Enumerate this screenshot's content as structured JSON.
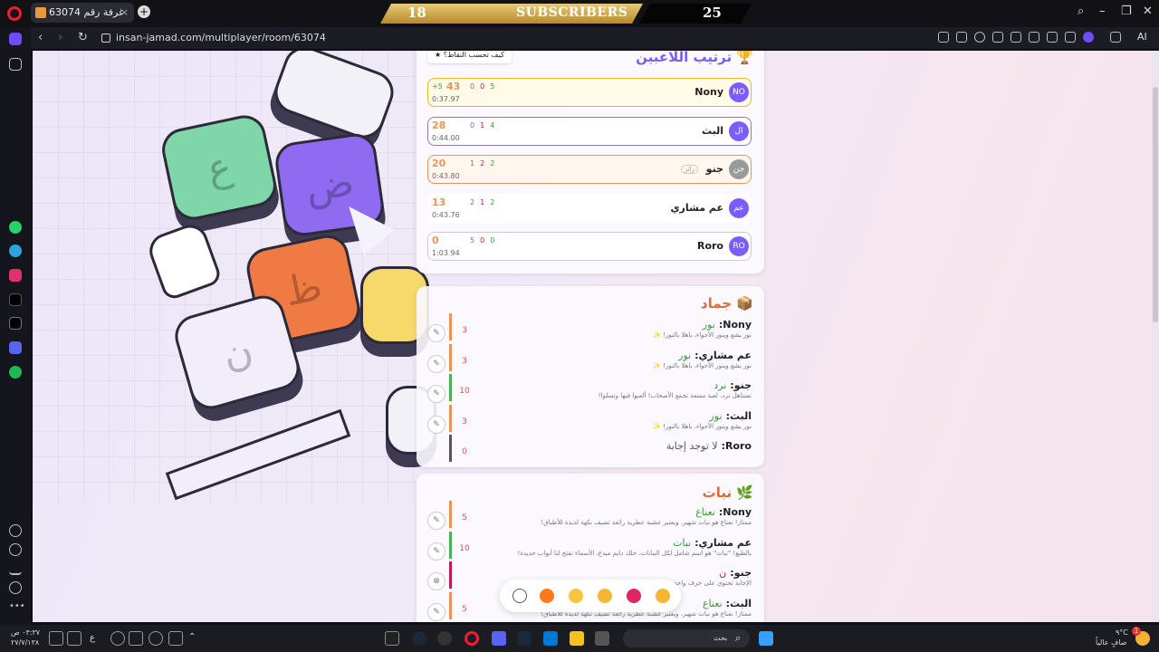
{
  "browser": {
    "tab_title": "غرفة رقم 63074",
    "url": "insan-jamad.com/multiplayer/room/63074",
    "ai_label": "AI"
  },
  "overlay": {
    "subs_left": "18",
    "subs_label": "SUBSCRIBERS",
    "subs_right": "25"
  },
  "leaderboard": {
    "title": "ترتيب اللاعبين",
    "points_help": "كيف تحسب النقاط؟",
    "players": [
      {
        "name": "Nony",
        "initials": "NO",
        "score": "43",
        "bonus": "+5",
        "correct": "5",
        "wrong": "0",
        "skip": "0",
        "time": "0:37.97",
        "color": "#7b5cff",
        "border": "#e8b923"
      },
      {
        "name": "البث",
        "initials": "ال",
        "score": "28",
        "correct": "4",
        "wrong": "1",
        "skip": "0",
        "time": "0:44.00",
        "color": "#7b5cff",
        "border": "#8a7bb8"
      },
      {
        "name": "جنو",
        "initials": "جن",
        "score": "20",
        "correct": "2",
        "wrong": "2",
        "skip": "1",
        "time": "0:43.80",
        "color": "#9a9a9a",
        "border": "#e8955a",
        "guest": "زائر"
      },
      {
        "name": "عم مشاري",
        "initials": "عم",
        "score": "13",
        "correct": "2",
        "wrong": "1",
        "skip": "2",
        "time": "0:43.76",
        "color": "#7b5cff",
        "border": "#ffffff"
      },
      {
        "name": "Roro",
        "initials": "RO",
        "score": "0",
        "correct": "0",
        "wrong": "0",
        "skip": "5",
        "time": "1:03.94",
        "color": "#7b5cff",
        "border": "#cccccc"
      }
    ]
  },
  "round_jamad": {
    "title": "جماد",
    "answers": [
      {
        "who": "Nony:",
        "word": "نور",
        "desc": "نور يشع وينور الأجواء، ياهلا بالنور! ✨",
        "points": "3",
        "bar": "#e8955a"
      },
      {
        "who": "عم مشاري:",
        "word": "نور",
        "desc": "نور يشع وينور الأجواء، ياهلا بالنور! ✨",
        "points": "3",
        "bar": "#e8955a"
      },
      {
        "who": "جنو:",
        "word": "نرد",
        "desc": "تستاهل نرد، لعبة ممتعة تجمع الأصحاب! ألعبوا فيها وتسلوا!",
        "points": "10",
        "bar": "#4caf50"
      },
      {
        "who": "البث:",
        "word": "نور",
        "desc": "نور يشع وينور الأجواء، ياهلا بالنور! ✨",
        "points": "3",
        "bar": "#e8955a"
      },
      {
        "who": "Roro:",
        "word": "لا توجد إجابة",
        "desc": "",
        "points": "0",
        "bar": "#555555"
      }
    ]
  },
  "round_nabat": {
    "title": "نبات",
    "answers": [
      {
        "who": "Nony:",
        "word": "نعناع",
        "desc": "ممتاز! نعناع هو نبات شهير، ويعتبر عشبة عطرية رائعة تضيف نكهة لذيذة للأطباق!",
        "points": "5",
        "bar": "#e8955a"
      },
      {
        "who": "عم مشاري:",
        "word": "نبات",
        "desc": "بالطبع! \"نبات\" هو اسم شامل لكل النباتات. خلك دايم مبدع، الأسماء تفتح لنا أبواب جديدة!",
        "points": "10",
        "bar": "#4caf50"
      },
      {
        "who": "جنو:",
        "word": "ن",
        "desc": "الإجابة تحتوي على حرف واحد",
        "points": "",
        "bar": "#c2185b"
      },
      {
        "who": "البث:",
        "word": "نعناع",
        "desc": "ممتاز! نعناع هو نبات شهير، ويعتبر عشبة عطرية رائعة تضيف نكهة لذيذة للأطباق!",
        "points": "5",
        "bar": "#e8955a"
      }
    ]
  },
  "keys": [
    "ع",
    "ض",
    "ظ",
    "ن"
  ],
  "taskbar": {
    "time": "٠٣:٣٧ ص",
    "date": "٢٧/٧/١٣٨",
    "lang": "ع",
    "search_placeholder": "بحث",
    "weather_temp": "٩°C",
    "weather_desc": "صافٍ عالياً",
    "notif_count": "1"
  }
}
